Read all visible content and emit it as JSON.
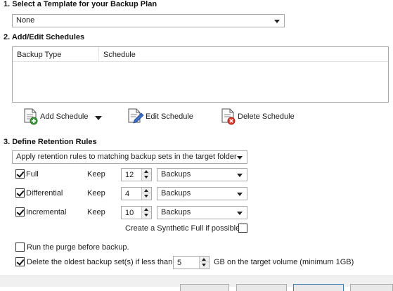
{
  "section1": {
    "title": "1. Select a Template for your Backup Plan",
    "template_value": "None"
  },
  "section2": {
    "title": "2. Add/Edit Schedules",
    "columns": [
      "Backup Type",
      "Schedule"
    ],
    "toolbar": {
      "add_label": "Add Schedule",
      "edit_label": "Edit Schedule",
      "delete_label": "Delete Schedule"
    }
  },
  "section3": {
    "title": "3. Define Retention Rules",
    "mode_value": "Apply retention rules to matching backup sets in the target folder",
    "rules": [
      {
        "label": "Full",
        "checked": true,
        "keep_label": "Keep",
        "count": "12",
        "unit": "Backups"
      },
      {
        "label": "Differential",
        "checked": true,
        "keep_label": "Keep",
        "count": "4",
        "unit": "Backups"
      },
      {
        "label": "Incremental",
        "checked": true,
        "keep_label": "Keep",
        "count": "10",
        "unit": "Backups"
      }
    ],
    "synthetic_label": "Create a Synthetic Full if possible",
    "synthetic_checked": false
  },
  "options": {
    "purge_label": "Run the purge before backup.",
    "purge_checked": false,
    "delete_oldest_label": "Delete the oldest backup set(s) if less than",
    "delete_oldest_checked": true,
    "delete_oldest_value": "5",
    "delete_oldest_suffix": "GB on the target volume (minimum 1GB)"
  }
}
